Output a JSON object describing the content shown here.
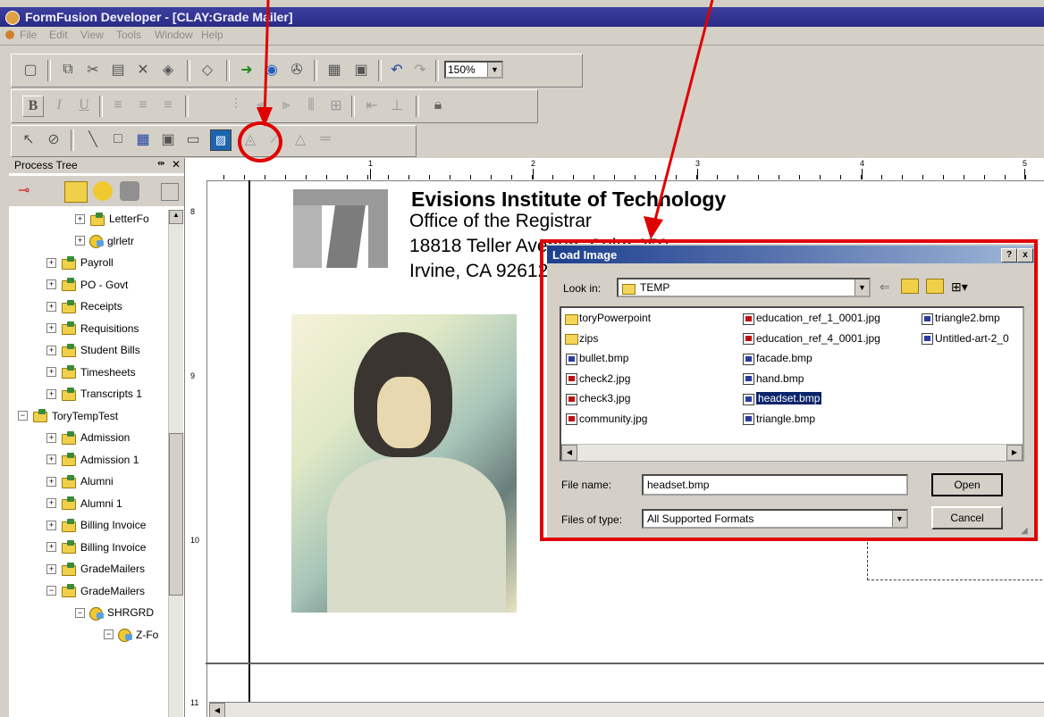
{
  "window": {
    "title": "FormFusion Developer - [CLAY:Grade Mailer]"
  },
  "menu": [
    "File",
    "Edit",
    "View",
    "Tools",
    "Window",
    "Help"
  ],
  "toolbar": {
    "zoom": "150%"
  },
  "process_tree": {
    "title": "Process Tree",
    "items": [
      {
        "label": "LetterFo",
        "indent": 2,
        "icon": "folder",
        "expanded": false
      },
      {
        "label": "glrletr",
        "indent": 2,
        "icon": "gear",
        "expanded": false
      },
      {
        "label": "Payroll",
        "indent": 1,
        "icon": "folder",
        "expanded": false
      },
      {
        "label": "PO - Govt",
        "indent": 1,
        "icon": "folder",
        "expanded": false
      },
      {
        "label": "Receipts",
        "indent": 1,
        "icon": "folder",
        "expanded": false
      },
      {
        "label": "Requisitions",
        "indent": 1,
        "icon": "folder",
        "expanded": false
      },
      {
        "label": "Student Bills",
        "indent": 1,
        "icon": "folder",
        "expanded": false
      },
      {
        "label": "Timesheets",
        "indent": 1,
        "icon": "folder",
        "expanded": false
      },
      {
        "label": "Transcripts 1",
        "indent": 1,
        "icon": "folder",
        "expanded": false
      },
      {
        "label": "ToryTempTest",
        "indent": 0,
        "icon": "folder",
        "expanded": true
      },
      {
        "label": "Admission",
        "indent": 1,
        "icon": "folder",
        "expanded": false
      },
      {
        "label": "Admission 1",
        "indent": 1,
        "icon": "folder",
        "expanded": false
      },
      {
        "label": "Alumni",
        "indent": 1,
        "icon": "folder",
        "expanded": false
      },
      {
        "label": "Alumni 1",
        "indent": 1,
        "icon": "folder",
        "expanded": false
      },
      {
        "label": "Billing Invoice",
        "indent": 1,
        "icon": "folder",
        "expanded": false
      },
      {
        "label": "Billing Invoice",
        "indent": 1,
        "icon": "folder",
        "expanded": false
      },
      {
        "label": "GradeMailers",
        "indent": 1,
        "icon": "folder",
        "expanded": false
      },
      {
        "label": "GradeMailers",
        "indent": 1,
        "icon": "folder",
        "expanded": true
      },
      {
        "label": "SHRGRD",
        "indent": 2,
        "icon": "gear",
        "expanded": true
      },
      {
        "label": "Z-Fo",
        "indent": 3,
        "icon": "gear",
        "expanded": true
      }
    ]
  },
  "document": {
    "institution": "Evisions Institute of Technology",
    "office": "Office of the Registrar",
    "address_line": "18818 Teller Avenue, Suite 250",
    "city_line": "Irvine, CA 92612",
    "ruler_top": [
      "1",
      "2",
      "3",
      "4",
      "5"
    ],
    "ruler_left": [
      "8",
      "9",
      "10",
      "11"
    ]
  },
  "dialog": {
    "title": "Load Image",
    "look_in_label": "Look in:",
    "look_in_value": "TEMP",
    "files_col1": [
      {
        "name": "toryPowerpoint",
        "type": "folder"
      },
      {
        "name": "zips",
        "type": "folder"
      },
      {
        "name": "bullet.bmp",
        "type": "bmp"
      },
      {
        "name": "check2.jpg",
        "type": "jpg"
      },
      {
        "name": "check3.jpg",
        "type": "jpg"
      },
      {
        "name": "community.jpg",
        "type": "jpg"
      }
    ],
    "files_col2": [
      {
        "name": "education_ref_1_0001.jpg",
        "type": "jpg"
      },
      {
        "name": "education_ref_4_0001.jpg",
        "type": "jpg"
      },
      {
        "name": "facade.bmp",
        "type": "bmp"
      },
      {
        "name": "hand.bmp",
        "type": "bmp"
      },
      {
        "name": "headset.bmp",
        "type": "bmp",
        "selected": true
      },
      {
        "name": "triangle.bmp",
        "type": "bmp"
      }
    ],
    "files_col3": [
      {
        "name": "triangle2.bmp",
        "type": "bmp"
      },
      {
        "name": "Untitled-art-2_0",
        "type": "bmp"
      }
    ],
    "file_name_label": "File name:",
    "file_name_value": "headset.bmp",
    "file_type_label": "Files of type:",
    "file_type_value": "All Supported Formats",
    "open_label": "Open",
    "cancel_label": "Cancel",
    "help_glyph": "?",
    "close_glyph": "x"
  },
  "colors": {
    "annotation": "#e00000",
    "titlebar": "#2a2c86",
    "dialog_title": "#1c3f8e",
    "selection": "#0a246a"
  }
}
